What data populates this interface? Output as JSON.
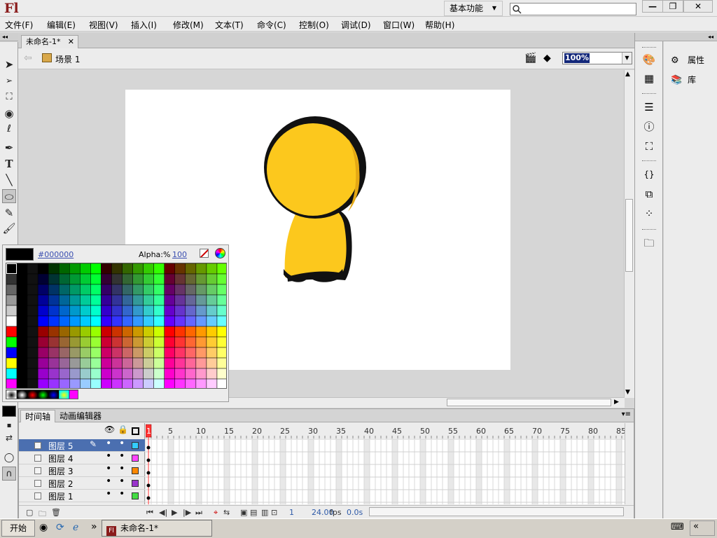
{
  "app": {
    "logo": "Fl",
    "workspace": "基本功能",
    "search_placeholder": ""
  },
  "window_controls": {
    "minimize": "—",
    "restore": "❐",
    "close": "✕"
  },
  "menu": [
    "文件(F)",
    "编辑(E)",
    "视图(V)",
    "插入(I)",
    "修改(M)",
    "文本(T)",
    "命令(C)",
    "控制(O)",
    "调试(D)",
    "窗口(W)",
    "帮助(H)"
  ],
  "document": {
    "tab_title": "未命名-1*",
    "scene": "场景 1",
    "zoom": "100%"
  },
  "swatches": {
    "current_hex": "#000000",
    "alpha_label": "Alpha:%",
    "alpha_value": "100"
  },
  "right_panel": {
    "properties": "属性",
    "library": "库"
  },
  "timeline": {
    "tabs": [
      "时间轴",
      "动画编辑器"
    ],
    "frame_numbers": [
      "1",
      "5",
      "10",
      "15",
      "20",
      "25",
      "30",
      "35",
      "40",
      "45",
      "50",
      "55",
      "60",
      "65",
      "70",
      "75",
      "80",
      "85"
    ],
    "layers": [
      {
        "name": "图层 5",
        "color": "#33ccff",
        "selected": true
      },
      {
        "name": "图层 4",
        "color": "#ff44ff",
        "selected": false
      },
      {
        "name": "图层 3",
        "color": "#ff8800",
        "selected": false
      },
      {
        "name": "图层 2",
        "color": "#9933cc",
        "selected": false
      },
      {
        "name": "图层 1",
        "color": "#44dd44",
        "selected": false
      }
    ],
    "current_frame": "1",
    "fps": "24.00",
    "fps_unit": "fps",
    "time": "0.0s"
  },
  "taskbar": {
    "start": "开始",
    "task": "未命名-1*",
    "chevron": "»",
    "tray_chevron": "«"
  },
  "colors": {
    "character_fill": "#fcc81d",
    "character_outline": "#111111",
    "selected_layer": "#4b6fb0",
    "playhead": "#ff3333"
  }
}
